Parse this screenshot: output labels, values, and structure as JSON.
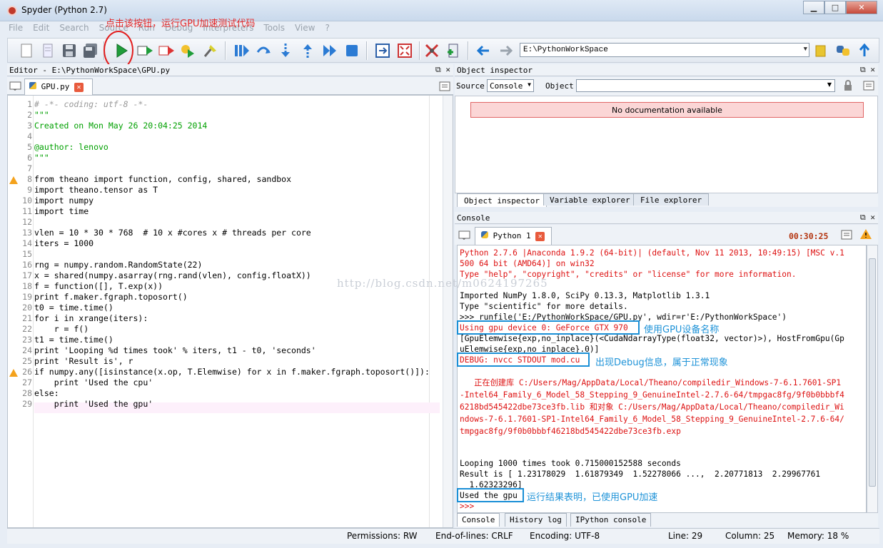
{
  "window": {
    "title": "Spyder (Python 2.7)",
    "btn_min": "▁",
    "btn_max": "□",
    "btn_close": "✕"
  },
  "menu": [
    "File",
    "Edit",
    "Search",
    "Source",
    "Run",
    "Debug",
    "Interpreters",
    "Tools",
    "View",
    "?"
  ],
  "annotation_top": "点击该按钮，运行GPU加速测试代码",
  "toolbar": {
    "path": "E:\\PythonWorkSpace"
  },
  "editor": {
    "header": "Editor - E:\\PythonWorkSpace\\GPU.py",
    "tab": "GPU.py",
    "lines": [
      {
        "n": "1",
        "t": "# -*- coding: utf-8 -*-"
      },
      {
        "n": "2",
        "t": "\"\"\""
      },
      {
        "n": "3",
        "t": "Created on Mon May 26 20:04:25 2014"
      },
      {
        "n": "4",
        "t": ""
      },
      {
        "n": "5",
        "t": "@author: lenovo"
      },
      {
        "n": "6",
        "t": "\"\"\""
      },
      {
        "n": "7",
        "t": ""
      },
      {
        "n": "8",
        "t": "from theano import function, config, shared, sandbox"
      },
      {
        "n": "9",
        "t": "import theano.tensor as T"
      },
      {
        "n": "10",
        "t": "import numpy"
      },
      {
        "n": "11",
        "t": "import time"
      },
      {
        "n": "12",
        "t": ""
      },
      {
        "n": "13",
        "t": "vlen = 10 * 30 * 768  # 10 x #cores x # threads per core"
      },
      {
        "n": "14",
        "t": "iters = 1000"
      },
      {
        "n": "15",
        "t": ""
      },
      {
        "n": "16",
        "t": "rng = numpy.random.RandomState(22)"
      },
      {
        "n": "17",
        "t": "x = shared(numpy.asarray(rng.rand(vlen), config.floatX))"
      },
      {
        "n": "18",
        "t": "f = function([], T.exp(x))"
      },
      {
        "n": "19",
        "t": "print f.maker.fgraph.toposort()"
      },
      {
        "n": "20",
        "t": "t0 = time.time()"
      },
      {
        "n": "21",
        "t": "for i in xrange(iters):"
      },
      {
        "n": "22",
        "t": "    r = f()"
      },
      {
        "n": "23",
        "t": "t1 = time.time()"
      },
      {
        "n": "24",
        "t": "print 'Looping %d times took' % iters, t1 - t0, 'seconds'"
      },
      {
        "n": "25",
        "t": "print 'Result is', r"
      },
      {
        "n": "26",
        "t": "if numpy.any([isinstance(x.op, T.Elemwise) for x in f.maker.fgraph.toposort()]):"
      },
      {
        "n": "27",
        "t": "    print 'Used the cpu'"
      },
      {
        "n": "28",
        "t": "else:"
      },
      {
        "n": "29",
        "t": "    print 'Used the gpu'"
      }
    ]
  },
  "inspector": {
    "header": "Object inspector",
    "source_label": "Source",
    "source_value": "Console",
    "object_label": "Object",
    "no_doc": "No documentation available",
    "tabs": [
      "Object inspector",
      "Variable explorer",
      "File explorer"
    ]
  },
  "console": {
    "header": "Console",
    "tab": "Python 1",
    "time": "00:30:25",
    "lines": [
      "Python 2.7.6 |Anaconda 1.9.2 (64-bit)| (default, Nov 11 2013, 10:49:15) [MSC v.1",
      "500 64 bit (AMD64)] on win32",
      "Type \"help\", \"copyright\", \"credits\" or \"license\" for more information.",
      "",
      "Imported NumPy 1.8.0, SciPy 0.13.3, Matplotlib 1.3.1",
      "Type \"scientific\" for more details.",
      ">>> runfile('E:/PythonWorkSpace/GPU.py', wdir=r'E:/PythonWorkSpace')",
      "Using gpu device 0: GeForce GTX 970",
      "[GpuElemwise{exp,no_inplace}(<CudaNdarrayType(float32, vector)>), HostFromGpu(Gp",
      "uElemwise{exp,no_inplace}.0)]",
      "DEBUG: nvcc STDOUT mod.cu",
      "",
      "   正在创建库 C:/Users/Mag/AppData/Local/Theano/compiledir_Windows-7-6.1.7601-SP1",
      "-Intel64_Family_6_Model_58_Stepping_9_GenuineIntel-2.7.6-64/tmpgac8fg/9f0b0bbbf4",
      "6218bd545422dbe73ce3fb.lib 和对象 C:/Users/Mag/AppData/Local/Theano/compiledir_Wi",
      "ndows-7-6.1.7601-SP1-Intel64_Family_6_Model_58_Stepping_9_GenuineIntel-2.7.6-64/",
      "tmpgac8fg/9f0b0bbbf46218bd545422dbe73ce3fb.exp",
      "",
      "",
      "Looping 1000 times took 0.715000152588 seconds",
      "Result is [ 1.23178029  1.61879349  1.52278066 ...,  2.20771813  2.29967761",
      "  1.62323296]",
      "Used the gpu",
      ">>>"
    ],
    "annot_gpu": "使用GPU设备名称",
    "annot_debug": "出现Debug信息，属于正常现象",
    "annot_result": "运行结果表明，已使用GPU加速",
    "tabs": [
      "Console",
      "History log",
      "IPython console"
    ]
  },
  "watermark": "http://blog.csdn.net/m0624197265",
  "status": {
    "permissions": "Permissions: RW",
    "eol": "End-of-lines: CRLF",
    "encoding": "Encoding: UTF-8",
    "line": "Line: 29",
    "column": "Column: 25",
    "memory": "Memory: 18 %"
  }
}
